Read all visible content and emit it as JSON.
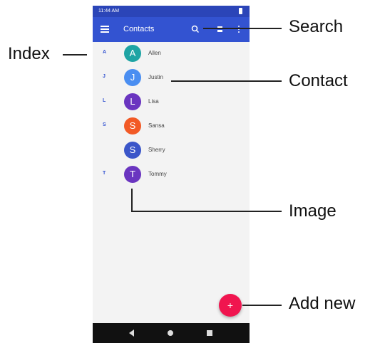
{
  "status_bar": {
    "time": "11:44 AM"
  },
  "app_bar": {
    "title": "Contacts"
  },
  "contacts": [
    {
      "index_letter": "A",
      "initial": "A",
      "name": "Allen",
      "color": "#1ea4a4"
    },
    {
      "index_letter": "J",
      "initial": "J",
      "name": "Justin",
      "color": "#4a8ef1"
    },
    {
      "index_letter": "L",
      "initial": "L",
      "name": "Lisa",
      "color": "#6a35c0"
    },
    {
      "index_letter": "S",
      "initial": "S",
      "name": "Sansa",
      "color": "#f25a26"
    },
    {
      "index_letter": "",
      "initial": "S",
      "name": "Sherry",
      "color": "#3b56c9"
    },
    {
      "index_letter": "T",
      "initial": "T",
      "name": "Tommy",
      "color": "#6a35c0"
    }
  ],
  "fab": {
    "label": "+"
  },
  "callouts": {
    "index": "Index",
    "search": "Search",
    "contact": "Contact",
    "image": "Image",
    "add_new": "Add new"
  },
  "colors": {
    "app_bar": "#3353d1",
    "status_bar": "#2b45b8",
    "fab": "#f0154f",
    "nav_bar": "#111111"
  }
}
